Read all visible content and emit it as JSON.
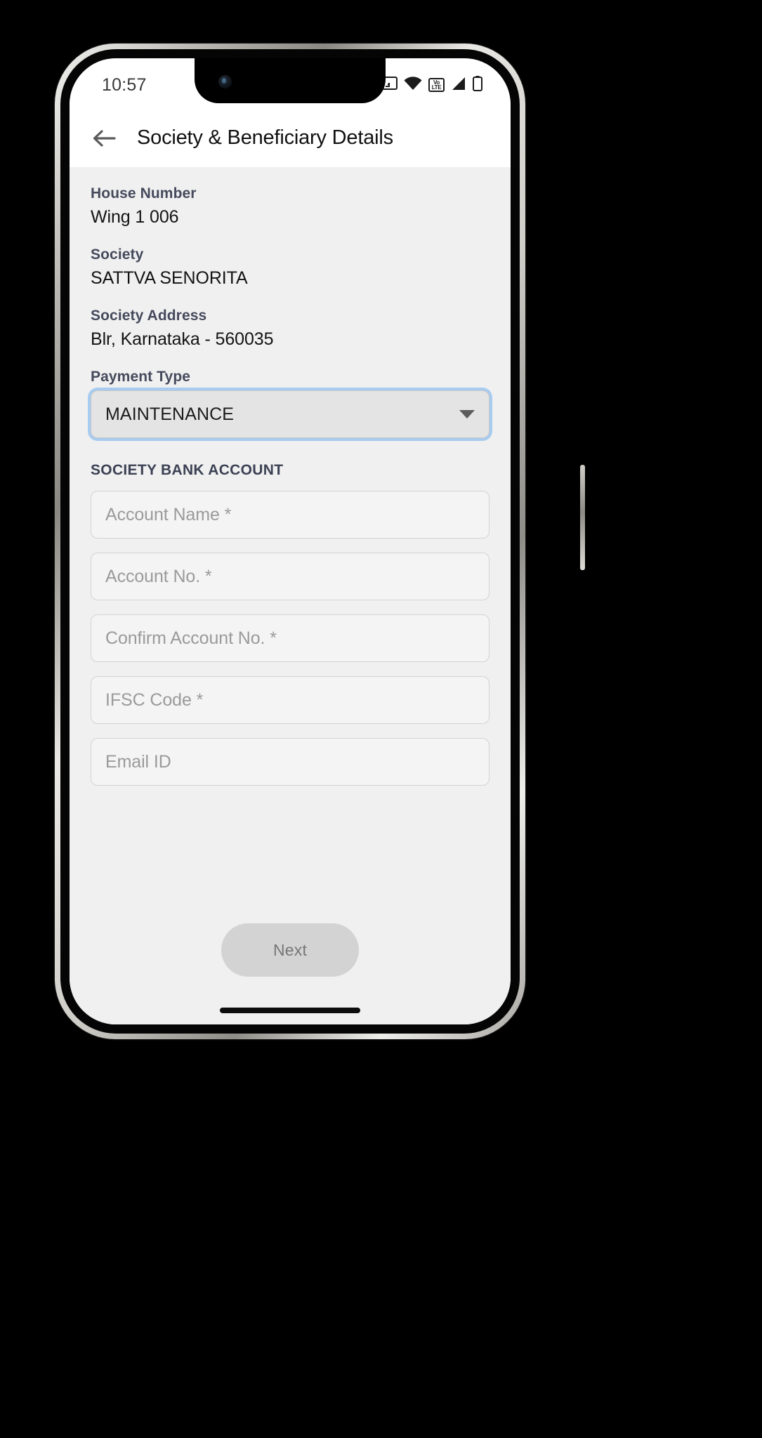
{
  "status_bar": {
    "time": "10:57",
    "icons": [
      {
        "name": "screen-cast-icon",
        "label": "cast"
      },
      {
        "name": "wifi-icon",
        "label": "wifi"
      },
      {
        "name": "volte-icon",
        "label_top": "Vo",
        "label_bottom": "LTE"
      },
      {
        "name": "cellular-signal-icon",
        "label": "signal"
      },
      {
        "name": "battery-icon",
        "label": "battery"
      }
    ]
  },
  "app_bar": {
    "back_icon": "arrow-left-icon",
    "title": "Society & Beneficiary Details"
  },
  "details": [
    {
      "label": "House Number",
      "value": "Wing 1 006"
    },
    {
      "label": "Society",
      "value": "SATTVA SENORITA"
    },
    {
      "label": "Society Address",
      "value": "Blr, Karnataka - 560035"
    }
  ],
  "payment_type": {
    "label": "Payment Type",
    "selected": "MAINTENANCE",
    "caret_icon": "chevron-down-icon",
    "focus_color": "#a8cbf0"
  },
  "bank_section": {
    "header": "SOCIETY BANK ACCOUNT",
    "fields": [
      {
        "name": "account-name-input",
        "placeholder": "Account Name *",
        "value": ""
      },
      {
        "name": "account-number-input",
        "placeholder": "Account No. *",
        "value": ""
      },
      {
        "name": "confirm-account-number-input",
        "placeholder": "Confirm Account No. *",
        "value": ""
      },
      {
        "name": "ifsc-code-input",
        "placeholder": "IFSC Code *",
        "value": ""
      },
      {
        "name": "email-id-input",
        "placeholder": "Email ID",
        "value": ""
      }
    ]
  },
  "footer": {
    "next_label": "Next"
  },
  "theme": {
    "content_background": "#f0f0f0",
    "label_color": "#454a5c",
    "value_color": "#131313",
    "placeholder_color": "#9a9a9a",
    "next_button_background": "#d3d3d3",
    "next_button_text": "#767676"
  }
}
